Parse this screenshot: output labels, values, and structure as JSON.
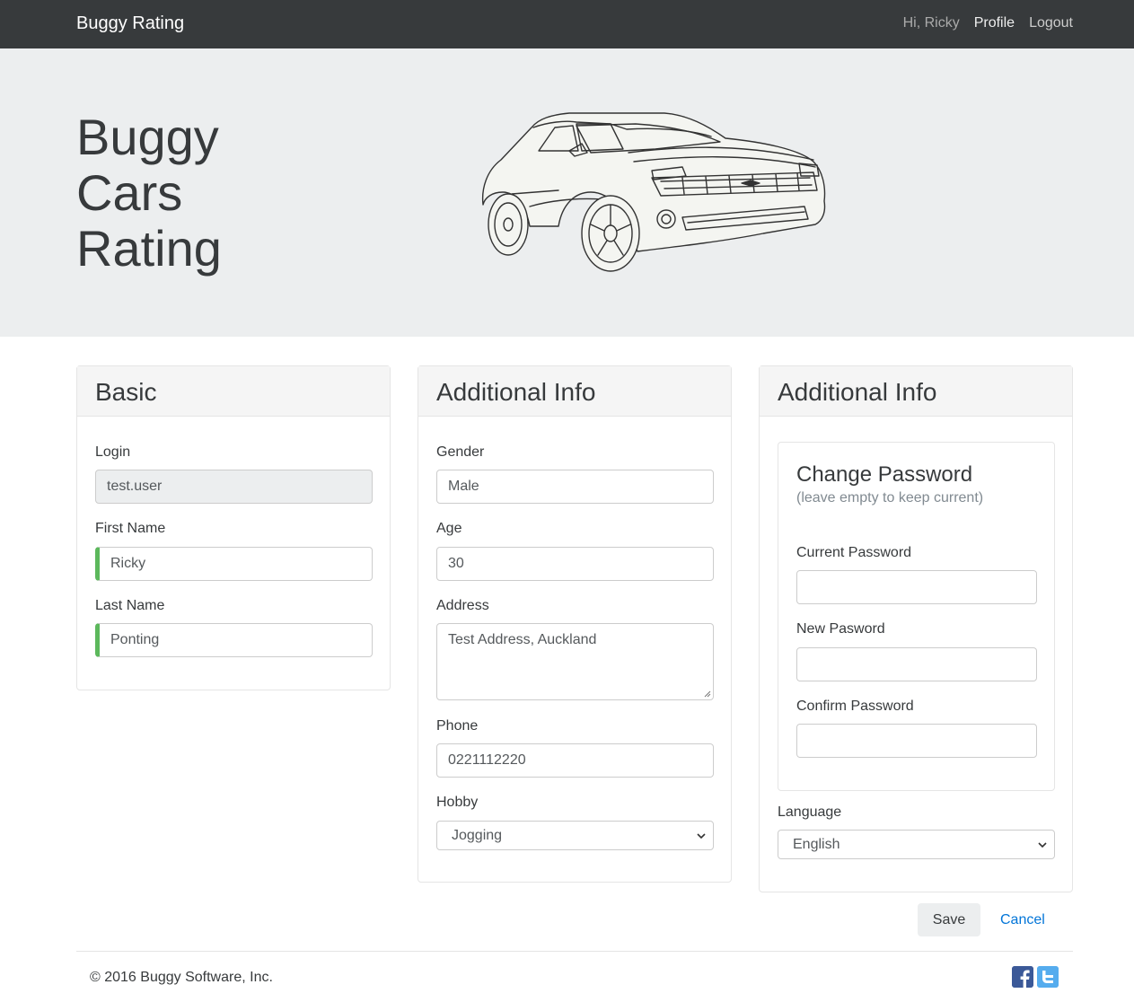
{
  "navbar": {
    "brand": "Buggy Rating",
    "greeting": "Hi, Ricky",
    "profile_link": "Profile",
    "logout_link": "Logout"
  },
  "hero": {
    "line1": "Buggy",
    "line2": "Cars",
    "line3": "Rating",
    "image": "car-sketch"
  },
  "basic": {
    "title": "Basic",
    "login_label": "Login",
    "login_value": "test.user",
    "first_name_label": "First Name",
    "first_name_value": "Ricky",
    "last_name_label": "Last Name",
    "last_name_value": "Ponting"
  },
  "additional": {
    "title": "Additional Info",
    "gender_label": "Gender",
    "gender_value": "Male",
    "age_label": "Age",
    "age_value": "30",
    "address_label": "Address",
    "address_value": "Test Address, Auckland",
    "phone_label": "Phone",
    "phone_value": "0221112220",
    "hobby_label": "Hobby",
    "hobby_value": "Jogging"
  },
  "password": {
    "card_title": "Additional Info",
    "title": "Change Password",
    "subtitle": "(leave empty to keep current)",
    "current_label": "Current Password",
    "current_value": "",
    "new_label": "New Pasword",
    "new_value": "",
    "confirm_label": "Confirm Password",
    "confirm_value": "",
    "language_label": "Language",
    "language_value": "English"
  },
  "actions": {
    "save": "Save",
    "cancel": "Cancel"
  },
  "footer": {
    "copyright": "© 2016 Buggy Software, Inc.",
    "icons": [
      "facebook-icon",
      "twitter-icon"
    ]
  },
  "colors": {
    "navbar_bg": "#373a3c",
    "hero_bg": "#eceeef",
    "valid_green": "#5cb85c",
    "link_blue": "#0275d8"
  }
}
